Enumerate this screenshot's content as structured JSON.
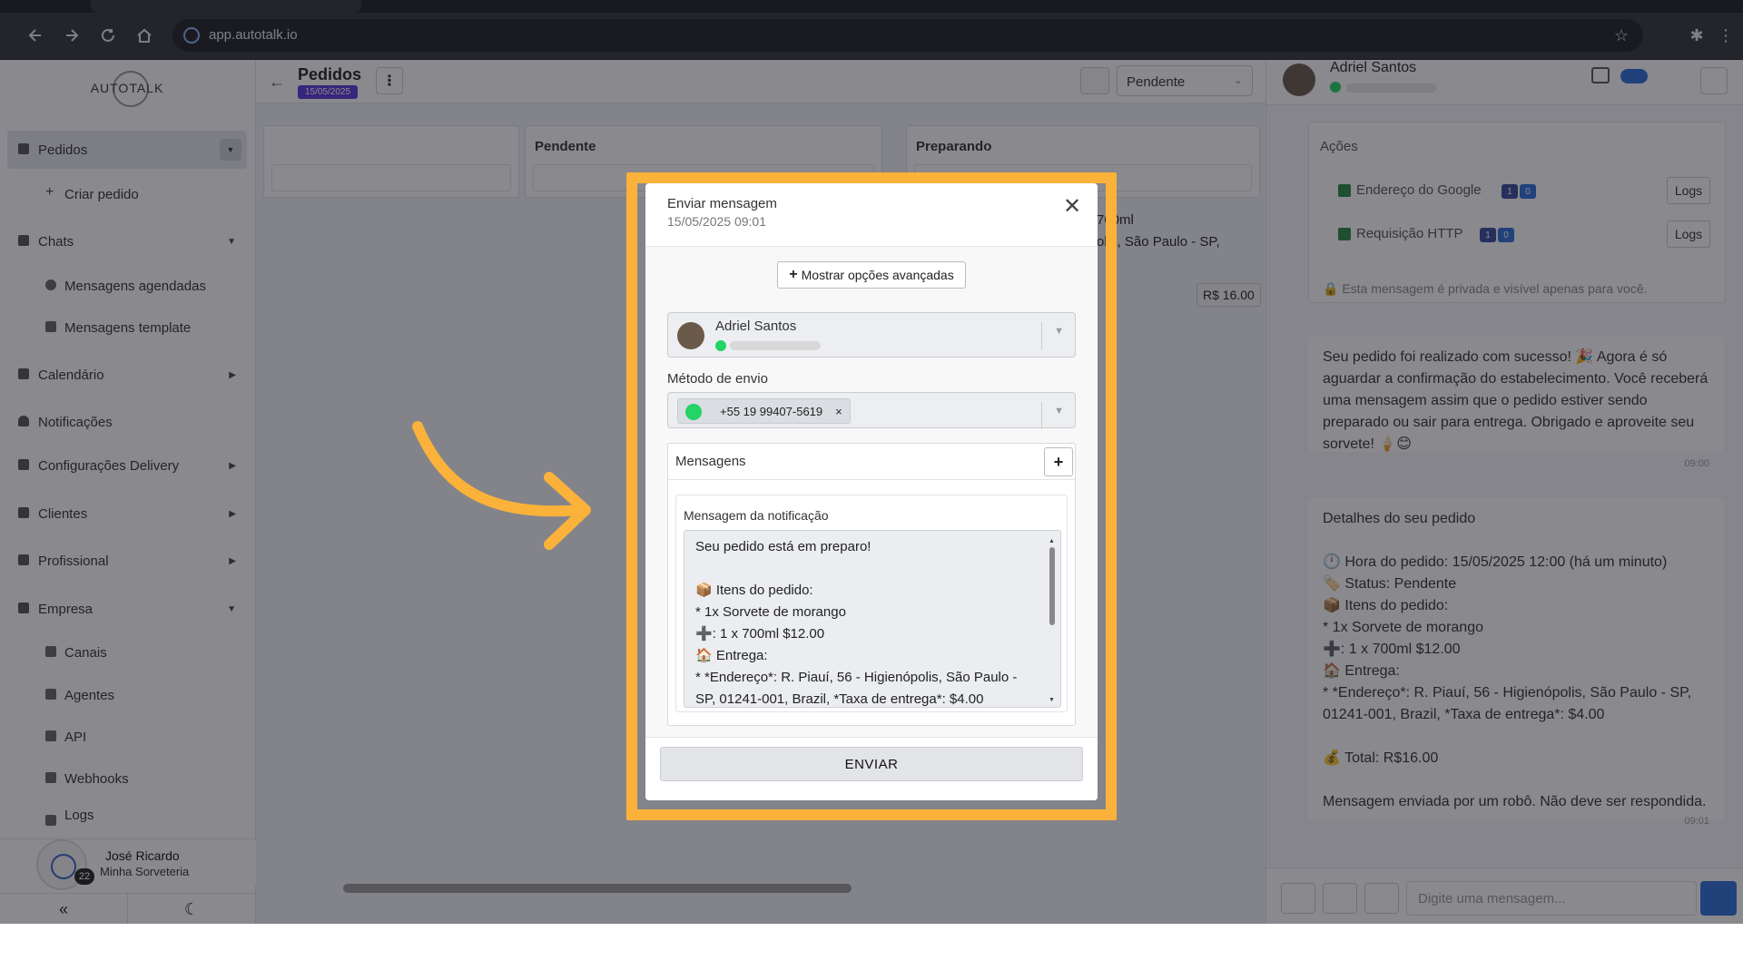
{
  "browser": {
    "url": "app.autotalk.io",
    "icons": [
      "back-icon",
      "forward-icon",
      "reload-icon",
      "home-icon",
      "star-icon",
      "extensions-icon",
      "menu-icon"
    ]
  },
  "sidebar": {
    "logo": "AUTOTALK",
    "items": [
      {
        "label": "Pedidos",
        "icon": "box-icon"
      },
      {
        "label": "Criar pedido",
        "icon": "plus-icon"
      },
      {
        "label": "Chats",
        "icon": "chat-icon"
      },
      {
        "label": "Mensagens agendadas",
        "icon": "clock-icon"
      },
      {
        "label": "Mensagens template",
        "icon": "template-icon"
      },
      {
        "label": "Calendário",
        "icon": "calendar-icon"
      },
      {
        "label": "Notificações",
        "icon": "bell-icon"
      },
      {
        "label": "Configurações Delivery",
        "icon": "sliders-icon"
      },
      {
        "label": "Clientes",
        "icon": "users-icon"
      },
      {
        "label": "Profissional",
        "icon": "user-tie-icon"
      },
      {
        "label": "Empresa",
        "icon": "building-icon"
      },
      {
        "label": "Canais",
        "icon": "link-icon"
      },
      {
        "label": "Agentes",
        "icon": "robot-icon"
      },
      {
        "label": "API",
        "icon": "api-icon"
      },
      {
        "label": "Webhooks",
        "icon": "webhook-icon"
      },
      {
        "label": "Logs",
        "icon": "list-icon"
      }
    ],
    "user": {
      "name": "José Ricardo",
      "org": "Minha Sorveteria",
      "badge": "22"
    },
    "footer": {
      "collapse": "«",
      "theme": "☾"
    }
  },
  "center": {
    "title": "Pedidos",
    "date": "15/05/2025",
    "status_filter": "Pendente",
    "columns": [
      "",
      "Pendente",
      "Preparando"
    ],
    "peek_line1": "700ml",
    "peek_line2": "olis, São Paulo - SP,",
    "price": "R$ 16.00"
  },
  "right": {
    "contact_name": "Adriel Santos",
    "actions_title": "Ações",
    "actions": [
      {
        "label": "Endereço do Google",
        "a": "1",
        "b": "0",
        "logs": "Logs"
      },
      {
        "label": "Requisição HTTP",
        "a": "1",
        "b": "0",
        "logs": "Logs"
      }
    ],
    "private_note": "Esta mensagem é privada e visível apenas para você.",
    "messages": [
      {
        "text": "Seu pedido foi realizado com sucesso! 🎉 Agora é só aguardar a confirmação do estabelecimento. Você receberá uma mensagem assim que o pedido estiver sendo preparado ou sair para entrega. Obrigado e aproveite seu sorvete! 🍦😊",
        "time": "09:00"
      },
      {
        "text": "Detalhes do seu pedido\n\n🕛 Hora do pedido: 15/05/2025 12:00 (há um minuto)\n🏷️ Status: Pendente\n📦 Itens do pedido:\n* 1x Sorvete de morango\n➕: 1 x 700ml $12.00\n🏠 Entrega:\n* *Endereço*: R. Piauí, 56 - Higienópolis, São Paulo - SP, 01241-001, Brazil, *Taxa de entrega*: $4.00\n\n💰 Total: R$16.00\n\nMensagem enviada por um robô. Não deve ser respondida.",
        "time": "09:01"
      }
    ],
    "composer_placeholder": "Digite uma mensagem..."
  },
  "modal": {
    "title": "Enviar mensagem",
    "date": "15/05/2025 09:01",
    "advanced_button": "Mostrar opções avançadas",
    "contact_name": "Adriel Santos",
    "method_label": "Método de envio",
    "method_chip": "+55 19 99407-5619",
    "messages_label": "Mensagens",
    "notification_label": "Mensagem da notificação",
    "notification_text": "Seu pedido está em preparo!\n\n📦 Itens do pedido:\n* 1x Sorvete de morango\n   ➕: 1 x 700ml $12.00\n🏠 Entrega:\n* *Endereço*: R. Piauí, 56 - Higienópolis, São Paulo - SP, 01241-001, Brazil, *Taxa de entrega*: $4.00",
    "send_button": "ENVIAR"
  },
  "colors": {
    "highlight": "#fbb23a",
    "brand": "#5b36d8",
    "whatsapp": "#25d366"
  }
}
